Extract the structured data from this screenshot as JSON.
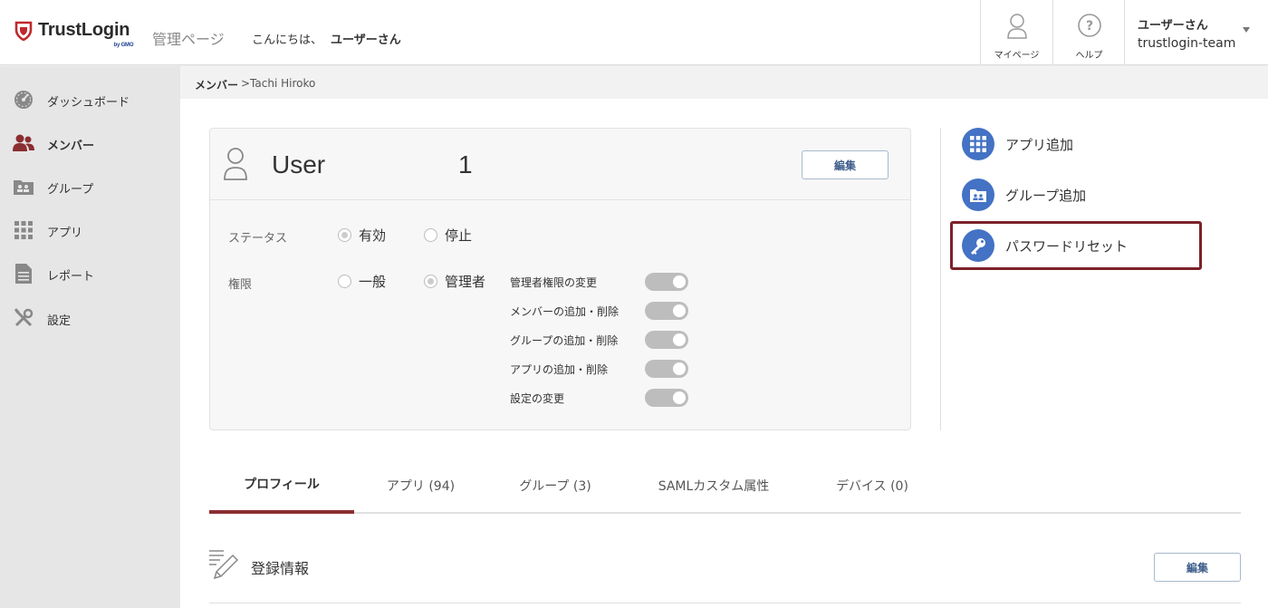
{
  "header": {
    "logo_text": "TrustLogin",
    "logo_by": "by GMO",
    "admin_title": "管理ページ",
    "greeting_prefix": "こんにちは、",
    "greeting_name": "ユーザーさん",
    "mypage_label": "マイページ",
    "help_label": "ヘルプ",
    "user_name": "ユーザーさん",
    "user_team": "trustlogin-team"
  },
  "sidebar": {
    "items": [
      {
        "label": "ダッシュボード",
        "icon": "dashboard-icon"
      },
      {
        "label": "メンバー",
        "icon": "members-icon",
        "active": true
      },
      {
        "label": "グループ",
        "icon": "group-icon"
      },
      {
        "label": "アプリ",
        "icon": "apps-grid-icon"
      },
      {
        "label": "レポート",
        "icon": "report-icon"
      },
      {
        "label": "設定",
        "icon": "settings-tools-icon"
      }
    ]
  },
  "breadcrumb": {
    "parent": "メンバー",
    "current": ">Tachi Hiroko"
  },
  "member_card": {
    "name": "User",
    "number": "1",
    "edit_label": "編集",
    "status_label": "ステータス",
    "status_options": [
      "有効",
      "停止"
    ],
    "status_selected": "有効",
    "role_label": "権限",
    "role_options": [
      "一般",
      "管理者"
    ],
    "role_selected": "管理者",
    "permissions": [
      {
        "label": "管理者権限の変更",
        "enabled": true
      },
      {
        "label": "メンバーの追加・削除",
        "enabled": true
      },
      {
        "label": "グループの追加・削除",
        "enabled": true
      },
      {
        "label": "アプリの追加・削除",
        "enabled": true
      },
      {
        "label": "設定の変更",
        "enabled": true
      }
    ]
  },
  "actions": [
    {
      "label": "アプリ追加",
      "icon": "apps-grid-icon"
    },
    {
      "label": "グループ追加",
      "icon": "group-folder-icon"
    },
    {
      "label": "パスワードリセット",
      "icon": "key-icon",
      "highlighted": true
    }
  ],
  "tabs": [
    {
      "label": "プロフィール",
      "active": true
    },
    {
      "label": "アプリ (94)"
    },
    {
      "label": "グループ (3)"
    },
    {
      "label": "SAMLカスタム属性"
    },
    {
      "label": "デバイス (0)"
    }
  ],
  "profile_section": {
    "title": "登録情報",
    "edit_label": "編集"
  },
  "colors": {
    "brand_red": "#c0282d",
    "accent_blue": "#4472c4",
    "active_tab": "#8b2e32",
    "sidebar_bg": "#e6e6e6"
  }
}
